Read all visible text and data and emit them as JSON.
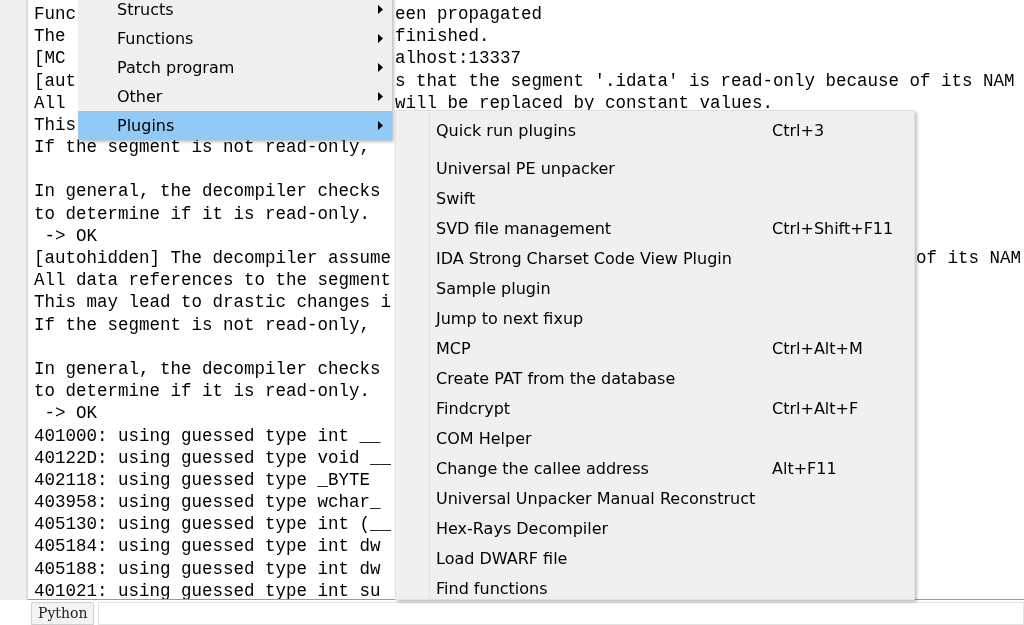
{
  "log": {
    "lines": [
      {
        "kind": "text",
        "left": "Func",
        "right": {
          "kind": "middle",
          "text": "een propagated"
        }
      },
      {
        "kind": "text",
        "left": "The",
        "right": {
          "kind": "middle",
          "text": "finished."
        }
      },
      {
        "kind": "text",
        "left": "[MC",
        "right": {
          "kind": "middle",
          "text": "alhost:13337"
        }
      },
      {
        "kind": "text",
        "left": "[aut",
        "right": {
          "kind": "middle",
          "text": "s that the segment '.idata' is read-only because of its NAM"
        }
      },
      {
        "kind": "text",
        "left": "All",
        "right": {
          "kind": "middle",
          "text": "will be replaced by constant values."
        }
      },
      {
        "kind": "text",
        "left": "This"
      },
      {
        "kind": "text",
        "left": "If the segment is not read-only,"
      },
      {
        "kind": "blank"
      },
      {
        "kind": "text",
        "left": "In general, the decompiler checks"
      },
      {
        "kind": "text",
        "left": "to determine if it is read-only."
      },
      {
        "kind": "text",
        "left": " -> OK"
      },
      {
        "kind": "text",
        "left": "[autohidden] The decompiler assume",
        "right": {
          "kind": "far",
          "text": "of its NAM"
        }
      },
      {
        "kind": "text",
        "left": "All data references to the segment"
      },
      {
        "kind": "text",
        "left": "This may lead to drastic changes i"
      },
      {
        "kind": "text",
        "left": "If the segment is not read-only,"
      },
      {
        "kind": "blank"
      },
      {
        "kind": "text",
        "left": "In general, the decompiler checks"
      },
      {
        "kind": "text",
        "left": "to determine if it is read-only."
      },
      {
        "kind": "text",
        "left": " -> OK"
      },
      {
        "kind": "text",
        "left": "401000: using guessed type int __"
      },
      {
        "kind": "text",
        "left": "40122D: using guessed type void __"
      },
      {
        "kind": "text",
        "left": "402118: using guessed type _BYTE"
      },
      {
        "kind": "text",
        "left": "403958: using guessed type wchar_"
      },
      {
        "kind": "text",
        "left": "405130: using guessed type int (__"
      },
      {
        "kind": "text",
        "left": "405184: using guessed type int dw"
      },
      {
        "kind": "text",
        "left": "405188: using guessed type int dw"
      },
      {
        "kind": "text",
        "left": "401021: using guessed type int su"
      }
    ]
  },
  "context_menu": {
    "items": [
      {
        "label": "Structs",
        "selected": false
      },
      {
        "label": "Functions",
        "selected": false
      },
      {
        "label": "Patch program",
        "selected": false
      },
      {
        "label": "Other",
        "selected": false
      },
      {
        "label": "Plugins",
        "selected": true
      }
    ]
  },
  "plugins_submenu": {
    "items": [
      {
        "kind": "item",
        "label": "Quick run plugins",
        "shortcut": "Ctrl+3"
      },
      {
        "kind": "separator"
      },
      {
        "kind": "item",
        "label": "Universal PE unpacker"
      },
      {
        "kind": "item",
        "label": "Swift"
      },
      {
        "kind": "item",
        "label": "SVD file management",
        "shortcut": "Ctrl+Shift+F11"
      },
      {
        "kind": "item",
        "label": "IDA Strong Charset Code View Plugin"
      },
      {
        "kind": "item",
        "label": "Sample plugin"
      },
      {
        "kind": "item",
        "label": "Jump to next fixup"
      },
      {
        "kind": "item",
        "label": "MCP",
        "shortcut": "Ctrl+Alt+M"
      },
      {
        "kind": "item",
        "label": "Create PAT from the database"
      },
      {
        "kind": "item",
        "label": "Findcrypt",
        "shortcut": "Ctrl+Alt+F"
      },
      {
        "kind": "item",
        "label": "COM Helper"
      },
      {
        "kind": "item",
        "label": "Change the callee address",
        "shortcut": "Alt+F11"
      },
      {
        "kind": "item",
        "label": "Universal Unpacker Manual Reconstruct"
      },
      {
        "kind": "item",
        "label": "Hex-Rays Decompiler"
      },
      {
        "kind": "item",
        "label": "Load DWARF file"
      },
      {
        "kind": "item",
        "label": "Find functions"
      }
    ]
  },
  "input_bar": {
    "mode_button": "Python"
  }
}
